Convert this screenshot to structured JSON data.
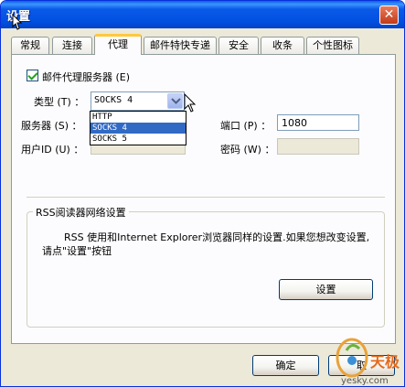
{
  "window": {
    "title": "设置",
    "close_glyph": "✕"
  },
  "tabs": [
    {
      "label": "常规",
      "active": false
    },
    {
      "label": "连接",
      "active": false
    },
    {
      "label": "代理",
      "active": true
    },
    {
      "label": "邮件特快专递",
      "active": false
    },
    {
      "label": "安全",
      "active": false
    },
    {
      "label": "收条",
      "active": false
    },
    {
      "label": "个性图标",
      "active": false
    }
  ],
  "proxy": {
    "enable_label": "邮件代理服务器 (E)",
    "enable_checked": true,
    "type_label": "类型 (T) ：",
    "type_value": "SOCKS 4",
    "type_options": [
      "HTTP",
      "SOCKS 4",
      "SOCKS 5"
    ],
    "type_selected": "SOCKS 4",
    "server_label": "服务器 (S) ：",
    "server_value": "",
    "port_label": "端口 (P) ：",
    "port_value": "1080",
    "userid_label": "用户ID (U) ：",
    "userid_value": "",
    "password_label": "密码 (W) ：",
    "password_value": ""
  },
  "rss": {
    "group_title": "RSS阅读器网络设置",
    "description": "RSS 使用和Internet Explorer浏览器同样的设置.如果您想改变设置,请点\"设置\"按钮",
    "settings_button": "设置"
  },
  "footer": {
    "ok_button": "确定",
    "cancel_button_partial": "取"
  },
  "watermark": {
    "brand": "天极",
    "domain": "yesky.com"
  },
  "colors": {
    "titlebar": "#0250E0",
    "dialog_bg": "#ECE9D8",
    "panel_bg": "#FCFCFE",
    "tab_highlight": "#FFC83C",
    "selection": "#316AC5",
    "checkmark": "#21A121"
  }
}
